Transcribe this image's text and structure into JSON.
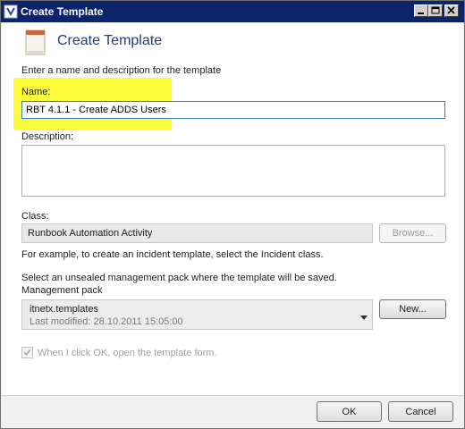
{
  "window": {
    "title": "Create Template",
    "icon": "template-app-icon",
    "controls": [
      "minimize-icon",
      "maximize-icon",
      "close-icon"
    ]
  },
  "header": {
    "title": "Create Template",
    "icon": "template-page-icon"
  },
  "form": {
    "instruction": "Enter a name and description for the template",
    "name_label": "Name:",
    "name_value": "RBT 4.1.1 - Create ADDS Users",
    "description_label": "Description:",
    "description_value": "",
    "class_label": "Class:",
    "class_value": "Runbook Automation Activity",
    "browse_label": "Browse...",
    "class_hint": "For example, to create an incident template, select the Incident class.",
    "mp_instruction": "Select an unsealed management pack where the template will be saved.",
    "mp_label": "Management pack",
    "mp_selected": "itnetx.templates",
    "mp_modified": "Last modified:  28.10.2011 15:05:00",
    "new_label": "New...",
    "open_form_label": "When I click OK, open the template form.",
    "open_form_checked": true
  },
  "footer": {
    "ok_label": "OK",
    "cancel_label": "Cancel"
  },
  "colors": {
    "titlebar": "#0b246a",
    "highlight": "#fbfb3c",
    "header_title": "#1e3a8a"
  }
}
